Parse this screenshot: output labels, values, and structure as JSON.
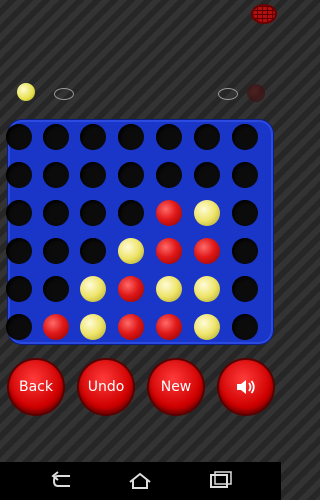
{
  "board": {
    "rows": 6,
    "cols": 7,
    "cells": [
      [
        "empty",
        "empty",
        "empty",
        "empty",
        "empty",
        "empty",
        "empty"
      ],
      [
        "empty",
        "empty",
        "empty",
        "empty",
        "empty",
        "empty",
        "empty"
      ],
      [
        "empty",
        "empty",
        "empty",
        "empty",
        "red",
        "yellow",
        "empty"
      ],
      [
        "empty",
        "empty",
        "empty",
        "yellow",
        "red",
        "red",
        "empty"
      ],
      [
        "empty",
        "empty",
        "yellow",
        "red",
        "yellow",
        "yellow",
        "empty"
      ],
      [
        "empty",
        "red",
        "yellow",
        "red",
        "red",
        "yellow",
        "empty"
      ]
    ]
  },
  "players": {
    "p1_color": "yellow",
    "p2_color": "red"
  },
  "buttons": {
    "back": "Back",
    "undo": "Undo",
    "new": "New",
    "sound_icon": "speaker-icon"
  },
  "colors": {
    "board": "#1a36c8",
    "red": "#e01818",
    "yellow": "#eee468",
    "button": "#d00000"
  },
  "nav": {
    "back_icon": "back-arrow-icon",
    "home_icon": "home-icon",
    "recents_icon": "recents-icon"
  }
}
